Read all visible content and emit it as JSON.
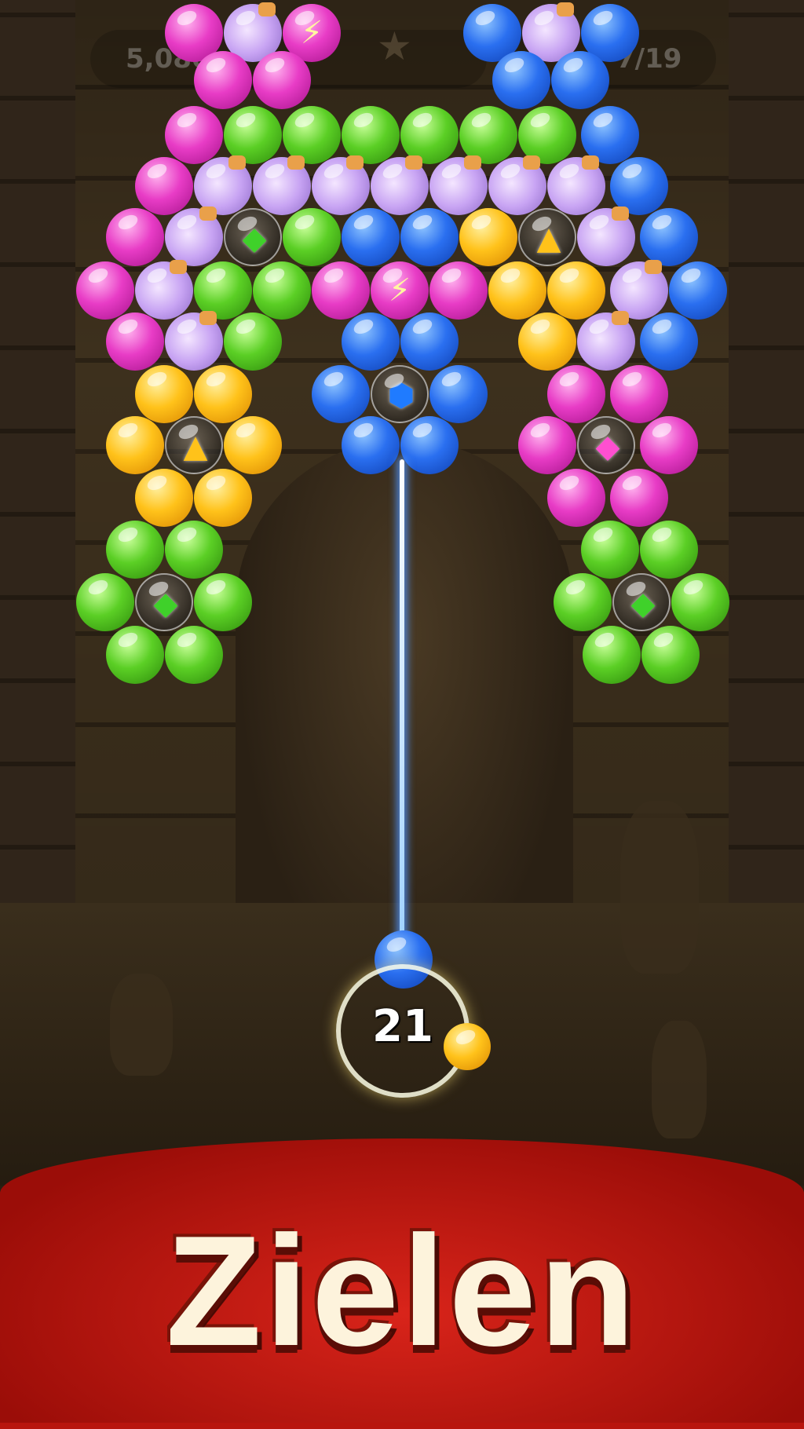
{
  "hud": {
    "score": "5,080",
    "level_progress": "7/19"
  },
  "shooter": {
    "moves_left": "21",
    "current_bubble_color": "blue",
    "next_bubble_color": "yellow"
  },
  "banner": {
    "title": "Zielen"
  },
  "colors": {
    "magenta": "#e83cc6",
    "green": "#5bcf25",
    "blue": "#2a6ff0",
    "yellow": "#ffc21a",
    "potion": "#c8a4f3",
    "banner_red": "#c51a12"
  }
}
